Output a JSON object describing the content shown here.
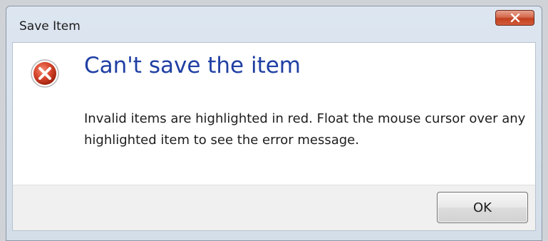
{
  "window": {
    "title": "Save Item"
  },
  "dialog": {
    "heading": "Can't save the item",
    "message": "Invalid items are highlighted in red.  Float the mouse cursor over any highlighted item to see the error message.",
    "icon": "error-icon"
  },
  "buttons": {
    "ok_label": "OK",
    "close_icon": "close-icon"
  },
  "colors": {
    "heading": "#1f3fa3",
    "error_red": "#d2412a",
    "close_red": "#c2401f"
  }
}
